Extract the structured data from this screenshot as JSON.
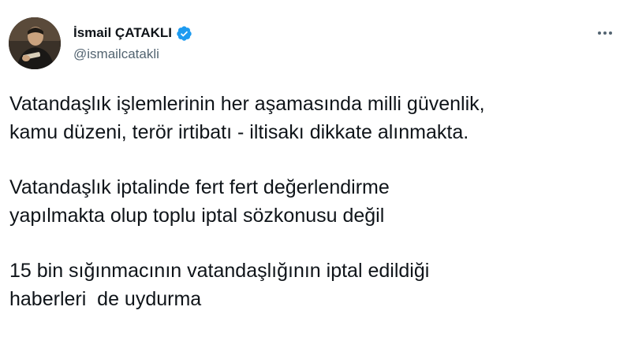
{
  "author": {
    "display_name": "İsmail ÇATAKLI",
    "handle": "@ismailcatakli",
    "verified": true,
    "verified_icon": "verified-badge-icon",
    "avatar_icon": "profile-avatar"
  },
  "menu": {
    "icon": "more-horizontal-icon"
  },
  "tweet": {
    "paragraphs": [
      {
        "lines": [
          "Vatandaşlık işlemlerinin her aşamasında milli güvenlik,",
          "kamu düzeni, terör irtibatı - iltisakı dikkate alınmakta."
        ]
      },
      {
        "lines": [
          "Vatandaşlık iptalinde fert fert değerlendirme",
          "yapılmakta olup toplu iptal sözkonusu değil"
        ]
      },
      {
        "lines": [
          "15 bin sığınmacının vatandaşlığının iptal edildiği",
          "haberleri  de uydurma"
        ]
      }
    ]
  },
  "colors": {
    "text_primary": "#0f1419",
    "text_secondary": "#536471",
    "verified_blue": "#1d9bf0",
    "background": "#ffffff"
  }
}
